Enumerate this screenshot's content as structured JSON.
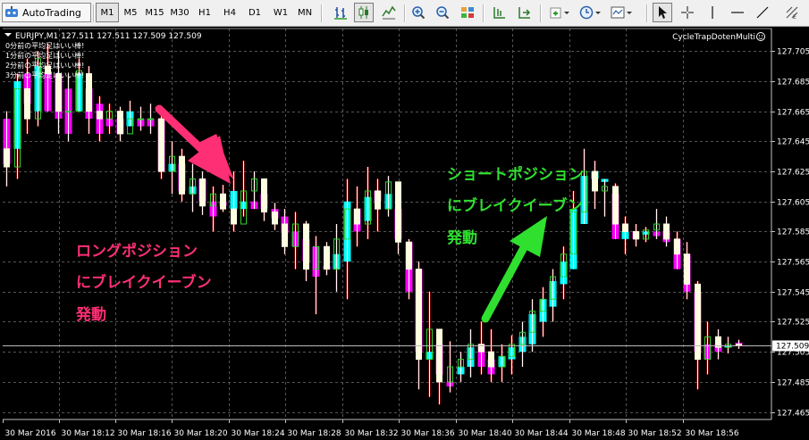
{
  "toolbar": {
    "autotrading_label": "AutoTrading",
    "timeframes": [
      "M1",
      "M5",
      "M15",
      "M30",
      "H1",
      "H4",
      "D1",
      "W1",
      "MN"
    ],
    "active_timeframe": "M1",
    "icons": [
      "bar-chart-icon",
      "candlestick-icon",
      "line-chart-icon",
      "zoom-in-icon",
      "zoom-out-icon",
      "tile-windows-icon",
      "chart-shift-icon",
      "autoscroll-icon",
      "indicators-icon",
      "periods-icon",
      "templates-icon",
      "cursor-icon",
      "crosshair-icon",
      "line-tools-icon"
    ]
  },
  "chart": {
    "symbol_line": "EURJPY,M1  127.511 127.511 127.509 127.509",
    "indicator_name": "CycleTrapDotenMulti",
    "info_lines": [
      "0分前の平均足はいい棒!",
      "1分前の平均足はいい棒!",
      "2分前の平均足はいい棒!",
      "3分前の平均足はいい棒!"
    ],
    "current_price": "127.509",
    "price_ticks": [
      "127.705",
      "127.685",
      "127.665",
      "127.645",
      "127.625",
      "127.605",
      "127.585",
      "127.565",
      "127.545",
      "127.525",
      "127.505",
      "127.485",
      "127.465"
    ],
    "time_ticks": [
      "30 Mar 2016",
      "30 Mar 18:12",
      "30 Mar 18:16",
      "30 Mar 18:20",
      "30 Mar 18:24",
      "30 Mar 18:28",
      "30 Mar 18:32",
      "30 Mar 18:36",
      "30 Mar 18:40",
      "30 Mar 18:44",
      "30 Mar 18:48",
      "30 Mar 18:52",
      "30 Mar 18:56"
    ],
    "colors": {
      "background": "#000000",
      "grid": "#555555",
      "candle_wick": "#ffffff",
      "ha_up": "#00ffff",
      "ha_down": "#ff00ff",
      "ha_up_wick": "#cc0000",
      "long_annotation": "#ff2f76",
      "short_annotation": "#2fe02f"
    }
  },
  "annotations": {
    "long": [
      "ロングポジション",
      "にブレイクイーブン",
      "発動"
    ],
    "short": [
      "ショートポジション",
      "にブレイクイーブン",
      "発動"
    ]
  },
  "chart_data": {
    "type": "candlestick",
    "symbol": "EURJPY",
    "timeframe": "M1",
    "ylim": [
      127.46,
      127.72
    ],
    "y_ticks": [
      127.705,
      127.685,
      127.665,
      127.645,
      127.625,
      127.605,
      127.585,
      127.565,
      127.545,
      127.525,
      127.505,
      127.485,
      127.465
    ],
    "x_ticks": [
      "30 Mar 2016",
      "30 Mar 18:12",
      "30 Mar 18:16",
      "30 Mar 18:20",
      "30 Mar 18:24",
      "30 Mar 18:28",
      "30 Mar 18:32",
      "30 Mar 18:36",
      "30 Mar 18:40",
      "30 Mar 18:44",
      "30 Mar 18:48",
      "30 Mar 18:52",
      "30 Mar 18:56"
    ],
    "candles": [
      {
        "o": 127.64,
        "h": 127.665,
        "l": 127.615,
        "c": 127.628,
        "ho": 127.66,
        "hc": 127.63
      },
      {
        "o": 127.628,
        "h": 127.69,
        "l": 127.62,
        "c": 127.68,
        "ho": 127.64,
        "hc": 127.685
      },
      {
        "o": 127.68,
        "h": 127.7,
        "l": 127.65,
        "c": 127.66,
        "ho": 127.69,
        "hc": 127.67
      },
      {
        "o": 127.66,
        "h": 127.705,
        "l": 127.655,
        "c": 127.7,
        "ho": 127.665,
        "hc": 127.695
      },
      {
        "o": 127.695,
        "h": 127.71,
        "l": 127.665,
        "c": 127.69,
        "ho": 127.69,
        "hc": 127.665
      },
      {
        "o": 127.69,
        "h": 127.705,
        "l": 127.65,
        "c": 127.665,
        "ho": 127.69,
        "hc": 127.66
      },
      {
        "o": 127.665,
        "h": 127.69,
        "l": 127.645,
        "c": 127.665,
        "ho": 127.68,
        "hc": 127.65
      },
      {
        "o": 127.665,
        "h": 127.7,
        "l": 127.665,
        "c": 127.692,
        "ho": 127.665,
        "hc": 127.69
      },
      {
        "o": 127.69,
        "h": 127.695,
        "l": 127.65,
        "c": 127.665,
        "ho": 127.68,
        "hc": 127.66
      },
      {
        "o": 127.665,
        "h": 127.675,
        "l": 127.645,
        "c": 127.66,
        "ho": 127.67,
        "hc": 127.65
      },
      {
        "o": 127.66,
        "h": 127.67,
        "l": 127.65,
        "c": 127.665,
        "ho": 127.66,
        "hc": 127.655
      },
      {
        "o": 127.665,
        "h": 127.668,
        "l": 127.645,
        "c": 127.65,
        "ho": 127.66,
        "hc": 127.65
      },
      {
        "o": 127.65,
        "h": 127.672,
        "l": 127.655,
        "c": 127.66,
        "ho": 127.655,
        "hc": 127.665
      },
      {
        "o": 127.66,
        "h": 127.668,
        "l": 127.652,
        "c": 127.66,
        "ho": 127.66,
        "hc": 127.655
      },
      {
        "o": 127.66,
        "h": 127.67,
        "l": 127.65,
        "c": 127.66,
        "ho": 127.66,
        "hc": 127.655
      },
      {
        "o": 127.66,
        "h": 127.662,
        "l": 127.62,
        "c": 127.625,
        "ho": 127.66,
        "hc": 127.625
      },
      {
        "o": 127.625,
        "h": 127.645,
        "l": 127.61,
        "c": 127.635,
        "ho": 127.625,
        "hc": 127.63
      },
      {
        "o": 127.635,
        "h": 127.64,
        "l": 127.605,
        "c": 127.61,
        "ho": 127.63,
        "hc": 127.612
      },
      {
        "o": 127.61,
        "h": 127.63,
        "l": 127.598,
        "c": 127.62,
        "ho": 127.61,
        "hc": 127.615
      },
      {
        "o": 127.62,
        "h": 127.625,
        "l": 127.596,
        "c": 127.602,
        "ho": 127.62,
        "hc": 127.605
      },
      {
        "o": 127.602,
        "h": 127.615,
        "l": 127.585,
        "c": 127.61,
        "ho": 127.605,
        "hc": 127.595
      },
      {
        "o": 127.61,
        "h": 127.616,
        "l": 127.598,
        "c": 127.6,
        "ho": 127.605,
        "hc": 127.602
      },
      {
        "o": 127.6,
        "h": 127.625,
        "l": 127.585,
        "c": 127.59,
        "ho": 127.6,
        "hc": 127.612
      },
      {
        "o": 127.59,
        "h": 127.632,
        "l": 127.595,
        "c": 127.612,
        "ho": 127.6,
        "hc": 127.605
      },
      {
        "o": 127.612,
        "h": 127.625,
        "l": 127.6,
        "c": 127.62,
        "ho": 127.605,
        "hc": 127.6
      },
      {
        "o": 127.62,
        "h": 127.618,
        "l": 127.592,
        "c": 127.598,
        "ho": 127.61,
        "hc": 127.6
      },
      {
        "o": 127.598,
        "h": 127.604,
        "l": 127.586,
        "c": 127.59,
        "ho": 127.6,
        "hc": 127.594
      },
      {
        "o": 127.59,
        "h": 127.6,
        "l": 127.57,
        "c": 127.575,
        "ho": 127.595,
        "hc": 127.584
      },
      {
        "o": 127.575,
        "h": 127.598,
        "l": 127.56,
        "c": 127.59,
        "ho": 127.585,
        "hc": 127.575
      },
      {
        "o": 127.59,
        "h": 127.592,
        "l": 127.552,
        "c": 127.56,
        "ho": 127.58,
        "hc": 127.565
      },
      {
        "o": 127.56,
        "h": 127.582,
        "l": 127.53,
        "c": 127.575,
        "ho": 127.575,
        "hc": 127.555
      },
      {
        "o": 127.575,
        "h": 127.578,
        "l": 127.556,
        "c": 127.56,
        "ho": 127.562,
        "hc": 127.56
      },
      {
        "o": 127.56,
        "h": 127.59,
        "l": 127.545,
        "c": 127.58,
        "ho": 127.56,
        "hc": 127.57
      },
      {
        "o": 127.58,
        "h": 127.62,
        "l": 127.54,
        "c": 127.6,
        "ho": 127.565,
        "hc": 127.605
      },
      {
        "o": 127.6,
        "h": 127.615,
        "l": 127.575,
        "c": 127.59,
        "ho": 127.6,
        "hc": 127.585
      },
      {
        "o": 127.59,
        "h": 127.628,
        "l": 127.58,
        "c": 127.612,
        "ho": 127.592,
        "hc": 127.608
      },
      {
        "o": 127.612,
        "h": 127.62,
        "l": 127.585,
        "c": 127.6,
        "ho": 127.612,
        "hc": 127.605
      },
      {
        "o": 127.6,
        "h": 127.622,
        "l": 127.595,
        "c": 127.618,
        "ho": 127.6,
        "hc": 127.61
      },
      {
        "o": 127.618,
        "h": 127.605,
        "l": 127.57,
        "c": 127.578,
        "ho": 127.6,
        "hc": 127.58
      },
      {
        "o": 127.578,
        "h": 127.58,
        "l": 127.54,
        "c": 127.56,
        "ho": 127.578,
        "hc": 127.545
      },
      {
        "o": 127.56,
        "h": 127.565,
        "l": 127.48,
        "c": 127.5,
        "ho": 127.56,
        "hc": 127.505
      },
      {
        "o": 127.5,
        "h": 127.545,
        "l": 127.475,
        "c": 127.52,
        "ho": 127.5,
        "hc": 127.505
      },
      {
        "o": 127.52,
        "h": 127.518,
        "l": 127.47,
        "c": 127.485,
        "ho": 127.51,
        "hc": 127.49
      },
      {
        "o": 127.485,
        "h": 127.512,
        "l": 127.478,
        "c": 127.495,
        "ho": 127.485,
        "hc": 127.482
      },
      {
        "o": 127.495,
        "h": 127.505,
        "l": 127.485,
        "c": 127.5,
        "ho": 127.49,
        "hc": 127.495
      },
      {
        "o": 127.5,
        "h": 127.52,
        "l": 127.488,
        "c": 127.51,
        "ho": 127.495,
        "hc": 127.508
      },
      {
        "o": 127.51,
        "h": 127.525,
        "l": 127.49,
        "c": 127.505,
        "ho": 127.51,
        "hc": 127.495
      },
      {
        "o": 127.505,
        "h": 127.52,
        "l": 127.485,
        "c": 127.495,
        "ho": 127.5,
        "hc": 127.49
      },
      {
        "o": 127.495,
        "h": 127.51,
        "l": 127.485,
        "c": 127.502,
        "ho": 127.495,
        "hc": 127.502
      },
      {
        "o": 127.502,
        "h": 127.516,
        "l": 127.49,
        "c": 127.51,
        "ho": 127.5,
        "hc": 127.508
      },
      {
        "o": 127.51,
        "h": 127.525,
        "l": 127.495,
        "c": 127.518,
        "ho": 127.505,
        "hc": 127.515
      },
      {
        "o": 127.518,
        "h": 127.54,
        "l": 127.505,
        "c": 127.532,
        "ho": 127.51,
        "hc": 127.53
      },
      {
        "o": 127.532,
        "h": 127.548,
        "l": 127.515,
        "c": 127.54,
        "ho": 127.525,
        "hc": 127.54
      },
      {
        "o": 127.54,
        "h": 127.56,
        "l": 127.525,
        "c": 127.555,
        "ho": 127.535,
        "hc": 127.552
      },
      {
        "o": 127.555,
        "h": 127.575,
        "l": 127.54,
        "c": 127.57,
        "ho": 127.55,
        "hc": 127.565
      },
      {
        "o": 127.57,
        "h": 127.612,
        "l": 127.56,
        "c": 127.598,
        "ho": 127.56,
        "hc": 127.6
      },
      {
        "o": 127.598,
        "h": 127.64,
        "l": 127.59,
        "c": 127.625,
        "ho": 127.59,
        "hc": 127.622
      },
      {
        "o": 127.625,
        "h": 127.632,
        "l": 127.6,
        "c": 127.612,
        "ho": 127.62,
        "hc": 127.625
      },
      {
        "o": 127.612,
        "h": 127.62,
        "l": 127.595,
        "c": 127.615,
        "ho": 127.618,
        "hc": 127.62
      },
      {
        "o": 127.615,
        "h": 127.617,
        "l": 127.58,
        "c": 127.59,
        "ho": 127.61,
        "hc": 127.58
      },
      {
        "o": 127.59,
        "h": 127.595,
        "l": 127.57,
        "c": 127.585,
        "ho": 127.58,
        "hc": 127.585
      },
      {
        "o": 127.585,
        "h": 127.59,
        "l": 127.575,
        "c": 127.58,
        "ho": 127.585,
        "hc": 127.58
      },
      {
        "o": 127.58,
        "h": 127.588,
        "l": 127.578,
        "c": 127.586,
        "ho": 127.583,
        "hc": 127.585
      },
      {
        "o": 127.586,
        "h": 127.6,
        "l": 127.58,
        "c": 127.59,
        "ho": 127.585,
        "hc": 127.582
      },
      {
        "o": 127.59,
        "h": 127.595,
        "l": 127.575,
        "c": 127.58,
        "ho": 127.585,
        "hc": 127.578
      },
      {
        "o": 127.58,
        "h": 127.585,
        "l": 127.56,
        "c": 127.57,
        "ho": 127.58,
        "hc": 127.56
      },
      {
        "o": 127.57,
        "h": 127.578,
        "l": 127.54,
        "c": 127.55,
        "ho": 127.57,
        "hc": 127.545
      },
      {
        "o": 127.55,
        "h": 127.552,
        "l": 127.48,
        "c": 127.5,
        "ho": 127.545,
        "hc": 127.505
      },
      {
        "o": 127.5,
        "h": 127.525,
        "l": 127.49,
        "c": 127.515,
        "ho": 127.51,
        "hc": 127.5
      },
      {
        "o": 127.515,
        "h": 127.52,
        "l": 127.5,
        "c": 127.508,
        "ho": 127.51,
        "hc": 127.505
      },
      {
        "o": 127.508,
        "h": 127.515,
        "l": 127.504,
        "c": 127.51,
        "ho": 127.508,
        "hc": 127.509
      },
      {
        "o": 127.51,
        "h": 127.513,
        "l": 127.507,
        "c": 127.509,
        "ho": 127.511,
        "hc": 127.509
      }
    ]
  }
}
